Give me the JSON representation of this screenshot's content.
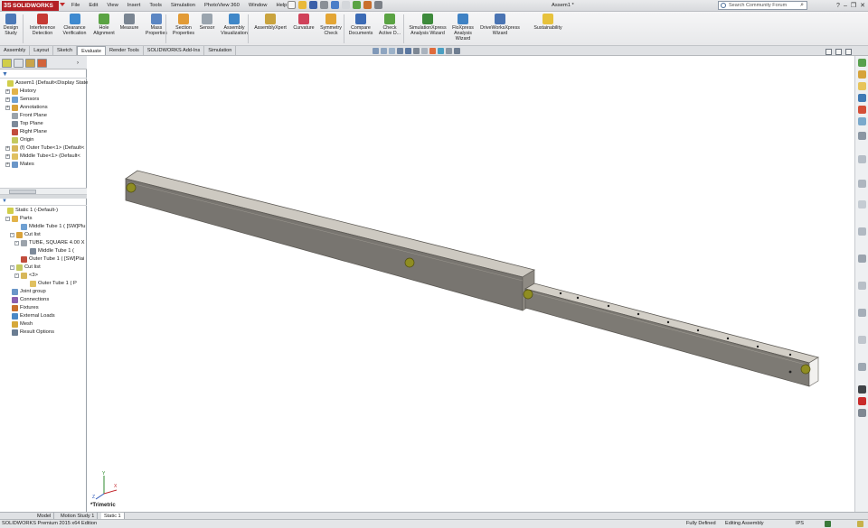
{
  "app": {
    "brand": "SOLIDWORKS",
    "document_title": "Assem1 *"
  },
  "menus": [
    "File",
    "Edit",
    "View",
    "Insert",
    "Tools",
    "Simulation",
    "PhotoView 360",
    "Window",
    "Help"
  ],
  "search": {
    "placeholder": "Search Community Forum"
  },
  "ribbon": [
    {
      "label": "Design Study",
      "icon": "design-study-icon"
    },
    {
      "label": "Interference Detection",
      "icon": "interference-icon"
    },
    {
      "label": "Clearance Verification",
      "icon": "clearance-icon"
    },
    {
      "label": "Hole Alignment",
      "icon": "hole-alignment-icon"
    },
    {
      "label": "Measure",
      "icon": "measure-icon"
    },
    {
      "label": "Mass Properties",
      "icon": "mass-properties-icon"
    },
    {
      "label": "Section Properties",
      "icon": "section-properties-icon"
    },
    {
      "label": "Sensor",
      "icon": "sensor-icon"
    },
    {
      "label": "Assembly Visualization",
      "icon": "assembly-visualization-icon"
    },
    {
      "label": "AssemblyXpert",
      "icon": "assemblyxpert-icon"
    },
    {
      "label": "Curvature",
      "icon": "curvature-icon"
    },
    {
      "label": "Symmetry Check",
      "icon": "symmetry-icon"
    },
    {
      "label": "Compare Documents",
      "icon": "compare-icon"
    },
    {
      "label": "Check Active D...",
      "icon": "check-icon"
    },
    {
      "label": "SimulationXpress Analysis Wizard",
      "icon": "simxpress-icon"
    },
    {
      "label": "FloXpress Analysis Wizard",
      "icon": "floxpress-icon"
    },
    {
      "label": "DriveWorksXpress Wizard",
      "icon": "driveworks-icon"
    },
    {
      "label": "Sustainability",
      "icon": "sustainability-icon"
    }
  ],
  "command_tabs": [
    "Assembly",
    "Layout",
    "Sketch",
    "Evaluate",
    "Render Tools",
    "SOLIDWORKS Add-Ins",
    "Simulation"
  ],
  "active_command_tab": "Evaluate",
  "feature_tree": [
    {
      "label": "Assem1  (Default<Display State",
      "indent": 0,
      "exp": ""
    },
    {
      "label": "History",
      "indent": 1,
      "exp": "+"
    },
    {
      "label": "Sensors",
      "indent": 1,
      "exp": "+"
    },
    {
      "label": "Annotations",
      "indent": 1,
      "exp": "+"
    },
    {
      "label": "Front Plane",
      "indent": 1,
      "exp": ""
    },
    {
      "label": "Top Plane",
      "indent": 1,
      "exp": ""
    },
    {
      "label": "Right Plane",
      "indent": 1,
      "exp": ""
    },
    {
      "label": "Origin",
      "indent": 1,
      "exp": ""
    },
    {
      "label": "(f) Outer Tube<1> (Default<",
      "indent": 1,
      "exp": "+"
    },
    {
      "label": "Middle Tube<1> (Default<",
      "indent": 1,
      "exp": "+"
    },
    {
      "label": "Mates",
      "indent": 1,
      "exp": "+"
    }
  ],
  "study_tree": [
    {
      "label": "Static 1 (-Default-)",
      "indent": 0,
      "exp": ""
    },
    {
      "label": "Parts",
      "indent": 1,
      "exp": "-"
    },
    {
      "label": "Middle Tube 1 ( [SW]Plu",
      "indent": 3,
      "exp": ""
    },
    {
      "label": "Cut list",
      "indent": 2,
      "exp": "-"
    },
    {
      "label": "TUBE, SQUARE 4.00 X",
      "indent": 3,
      "exp": "-"
    },
    {
      "label": "Middle Tube 1 (",
      "indent": 5,
      "exp": ""
    },
    {
      "label": "Outer Tube 1 ( [SW]Plai",
      "indent": 3,
      "exp": ""
    },
    {
      "label": "Cut list",
      "indent": 2,
      "exp": "-"
    },
    {
      "label": "<3>",
      "indent": 3,
      "exp": "-"
    },
    {
      "label": "Outer Tube 1 ( P",
      "indent": 5,
      "exp": ""
    },
    {
      "label": "Joint group",
      "indent": 1,
      "exp": ""
    },
    {
      "label": "Connections",
      "indent": 1,
      "exp": ""
    },
    {
      "label": "Fixtures",
      "indent": 1,
      "exp": ""
    },
    {
      "label": "External Loads",
      "indent": 1,
      "exp": ""
    },
    {
      "label": "Mesh",
      "indent": 1,
      "exp": ""
    },
    {
      "label": "Result Options",
      "indent": 1,
      "exp": ""
    }
  ],
  "viewport": {
    "view_orientation": "*Trimetric",
    "axis_labels": [
      "X",
      "Y",
      "Z"
    ]
  },
  "model_tabs": [
    "Model",
    "Motion Study 1",
    "Static 1"
  ],
  "active_model_tab": "Static 1",
  "status": {
    "edition": "SOLIDWORKS Premium 2015 x64 Edition",
    "definition": "Fully Defined",
    "mode": "Editing Assembly",
    "units": "IPS"
  },
  "colors": {
    "brand_red": "#b32026",
    "beam_top": "#c8c4bc",
    "beam_side": "#77736c",
    "joint_ball": "#8f8d22"
  }
}
